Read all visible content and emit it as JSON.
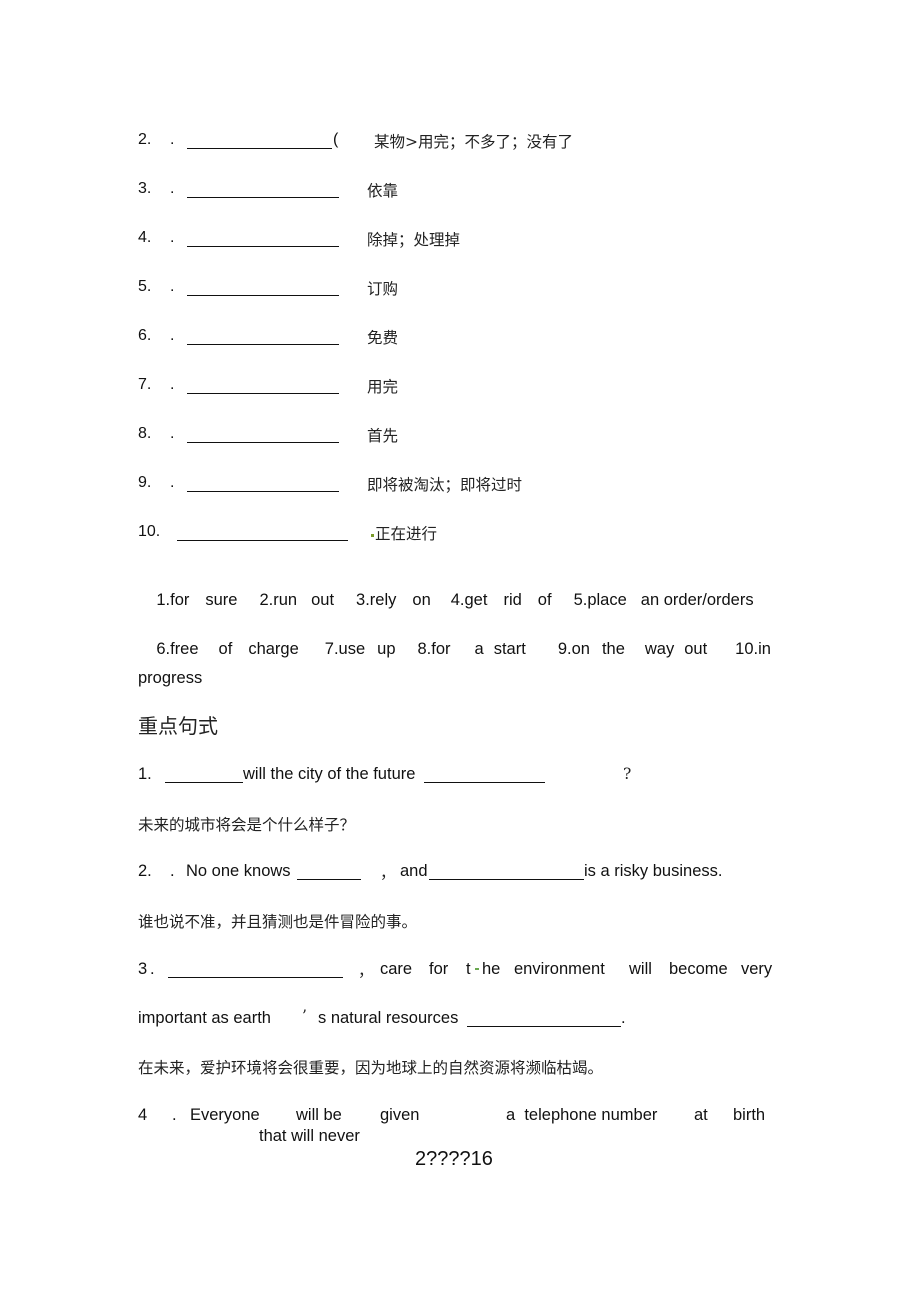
{
  "vocab_items": [
    {
      "number": "2.",
      "dot": ".",
      "paren": "(",
      "meaning": "某物>用完；不多了；没有了"
    },
    {
      "number": "3.",
      "dot": ".",
      "meaning": "依靠"
    },
    {
      "number": "4.",
      "dot": ".",
      "meaning": "除掉；处理掉"
    },
    {
      "number": "5.",
      "dot": ".",
      "meaning": "订购"
    },
    {
      "number": "6.",
      "dot": ".",
      "meaning": "免费"
    },
    {
      "number": "7.",
      "dot": ".",
      "meaning": "用完"
    },
    {
      "number": "8.",
      "dot": ".",
      "meaning": "首先"
    },
    {
      "number": "9.",
      "dot": ".",
      "meaning": "即将被淘汰；即将过时"
    },
    {
      "number": "10.",
      "meaning": "正在进行"
    }
  ],
  "answers": {
    "line1": [
      "1.for",
      "sure",
      "2.run",
      "out",
      "3.rely",
      "on",
      "4.get",
      "rid",
      "of",
      "5.place",
      "an order/orders"
    ],
    "line2": [
      "6.free",
      "of",
      "charge",
      "7.use",
      "up",
      "8.for",
      "a",
      "start",
      "9.on",
      "the",
      "way",
      "out",
      "10.in"
    ],
    "line3": "progress"
  },
  "section_title": "重点句式",
  "sentences": {
    "s1": {
      "number": "1.",
      "text_mid": "will the city of the future",
      "question_mark": "?",
      "translation": "未来的城市将会是个什么样子？"
    },
    "s2": {
      "number": "2.",
      "dot": ".",
      "text_a": "No one knows",
      "comma": "，",
      "text_b": "and",
      "text_c": "is a risky business.",
      "translation": "谁也说不准，并且猜测也是件冒险的事。"
    },
    "s3": {
      "number": "3",
      "dot": ".",
      "comma": "，",
      "words": [
        "care",
        "for",
        "t",
        "he",
        "environment",
        "will",
        "become",
        "very"
      ],
      "line2_a": "important as earth",
      "apostrophe": "’",
      "line2_b": "s natural resources",
      "period": ".",
      "translation": "在未来，爱护环境将会很重要，因为地球上的自然资源将濒临枯竭。"
    },
    "s4": {
      "number": "4",
      "dot": ".",
      "words": [
        "Everyone",
        "will be",
        "given",
        "a  telephone number",
        "at",
        "birth"
      ],
      "line2": "that will never"
    }
  },
  "footer": {
    "page_label": "2????16"
  }
}
